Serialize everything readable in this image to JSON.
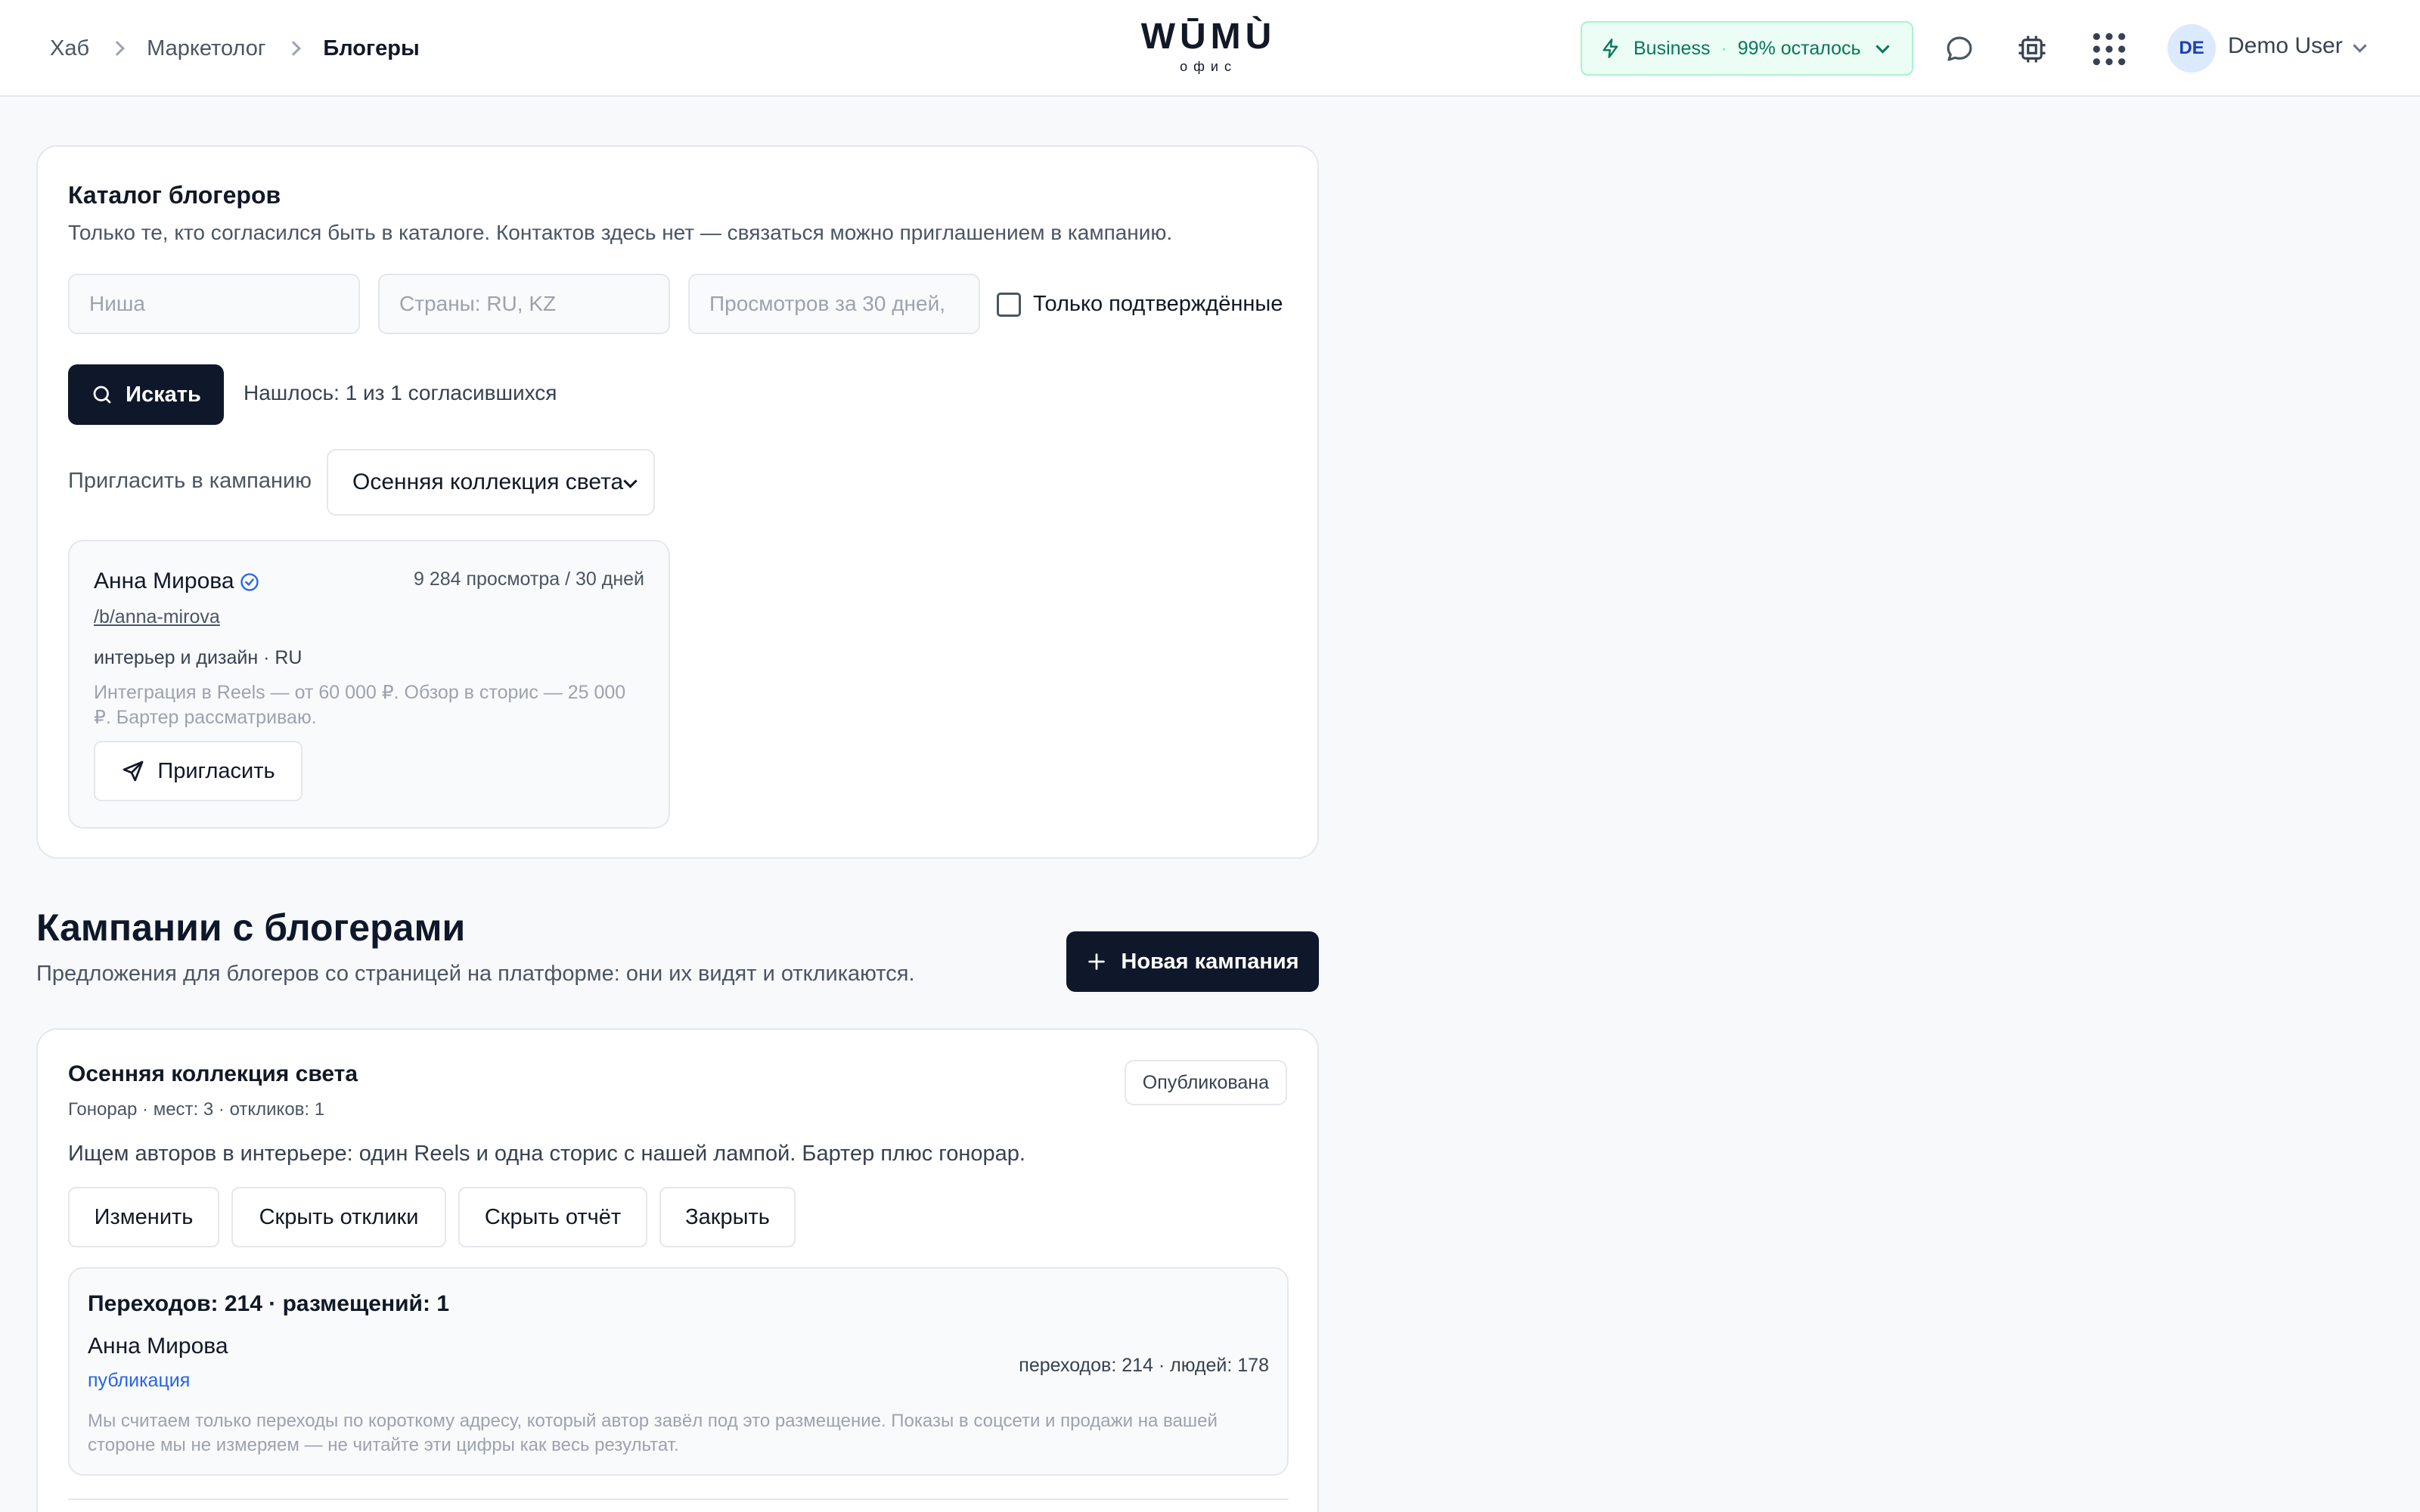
{
  "breadcrumb": [
    "Хаб",
    "Маркетолог",
    "Блогеры"
  ],
  "logo": {
    "mark": "WŪMÙ",
    "sub": "офис"
  },
  "plan": {
    "name": "Business",
    "remaining": "99% осталось"
  },
  "user": {
    "initials": "DE",
    "name": "Demo User"
  },
  "catalog": {
    "title": "Каталог блогеров",
    "subtitle": "Только те, кто согласился быть в каталоге. Контактов здесь нет — связаться можно приглашением в кампанию.",
    "filters": {
      "niche_placeholder": "Ниша",
      "countries_placeholder": "Страны: RU, KZ",
      "views_placeholder": "Просмотров за 30 дней,",
      "verified_only_label": "Только подтверждённые",
      "verified_only_checked": false
    },
    "search_label": "Искать",
    "found_text": "Нашлось: 1 из 1 согласившихся",
    "invite_label": "Пригласить в кампанию",
    "campaign_select": "Осенняя коллекция света",
    "bloggers": [
      {
        "name": "Анна Мирова",
        "verified": true,
        "views": "9 284 просмотра / 30 дней",
        "link": "/b/anna-mirova",
        "tags": "интерьер и дизайн · RU",
        "note": "Интеграция в Reels — от 60 000 ₽. Обзор в сторис — 25 000 ₽. Бартер рассматриваю.",
        "invite_button": "Пригласить"
      }
    ]
  },
  "campaigns": {
    "title": "Кампании с блогерами",
    "subtitle": "Предложения для блогеров со страницей на платформе: они их видят и откликаются.",
    "new_button": "Новая кампания",
    "items": [
      {
        "title": "Осенняя коллекция света",
        "meta": "Гонорар · мест: 3 · откликов: 1",
        "status": "Опубликована",
        "description": "Ищем авторов в интерьере: один Reels и одна сторис с нашей лампой. Бартер плюс гонорар.",
        "actions": [
          "Изменить",
          "Скрыть отклики",
          "Скрыть отчёт",
          "Закрыть"
        ],
        "report": {
          "summary": "Переходов: 214 · размещений: 1",
          "rows": [
            {
              "name": "Анна Мирова",
              "link": "публикация",
              "numbers": "переходов: 214 · людей: 178"
            }
          ],
          "note": "Мы считаем только переходы по короткому адресу, который автор завёл под это размещение. Показы в соцсети и продажи на вашей стороне мы не измеряем — не читайте эти цифры как весь результат."
        }
      }
    ]
  },
  "colors": {
    "accent_dark": "#0f172a",
    "plan_green": "#047857",
    "link_blue": "#2563eb"
  }
}
